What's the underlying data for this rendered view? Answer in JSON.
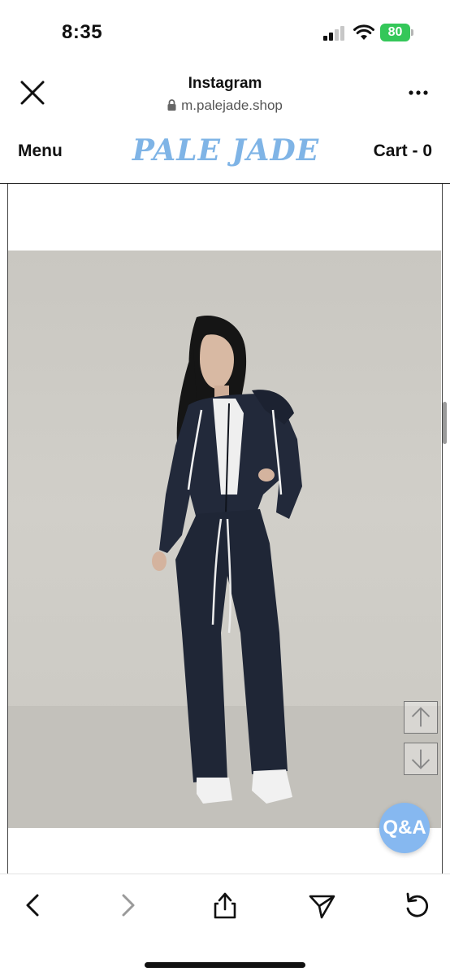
{
  "status_bar": {
    "time": "8:35",
    "battery": "80"
  },
  "browser_header": {
    "title": "Instagram",
    "url": "m.palejade.shop"
  },
  "site_nav": {
    "menu_label": "Menu",
    "logo": "PALE JADE",
    "cart_label": "Cart - 0"
  },
  "floating": {
    "qa_label": "Q&A"
  },
  "icons": {
    "close": "close-icon",
    "more": "more-icon",
    "lock": "lock-icon",
    "scroll_up": "arrow-up-icon",
    "scroll_down": "arrow-down-icon",
    "back": "chevron-left-icon",
    "forward": "chevron-right-icon",
    "share": "share-icon",
    "send": "send-icon",
    "reload": "reload-icon"
  },
  "colors": {
    "logo": "#7fb4e6",
    "qa_button": "#86b8f0",
    "battery": "#34c759"
  }
}
